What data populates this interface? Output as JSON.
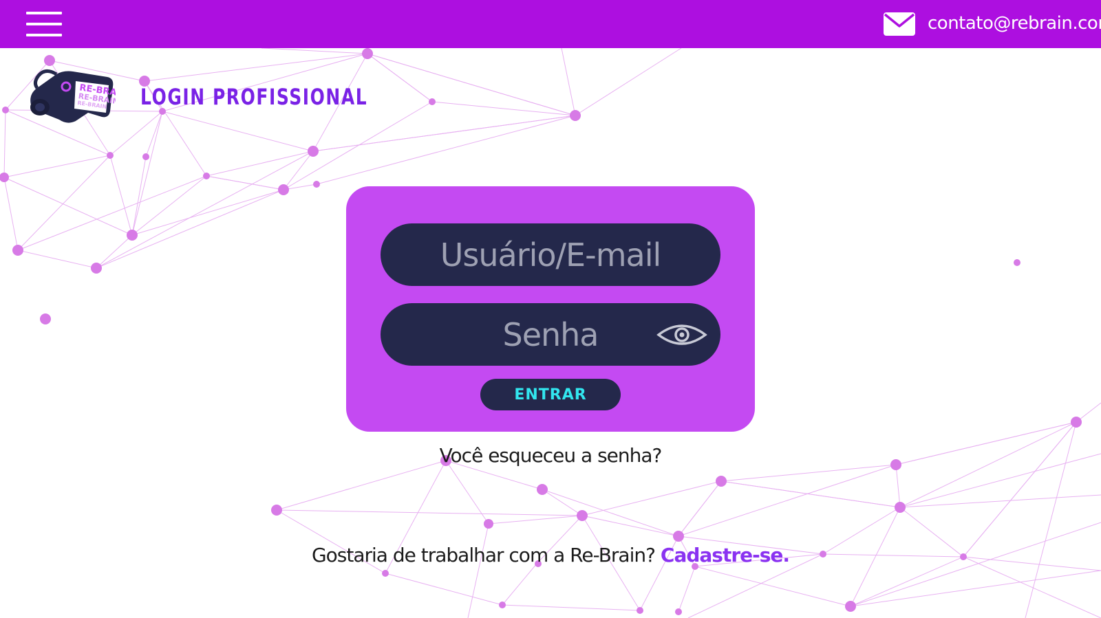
{
  "header": {
    "menu_icon": "hamburger-menu-icon",
    "mail_icon": "envelope-icon",
    "contact_email": "contato@rebrain.com"
  },
  "brand": {
    "logo_text": "RE-BRAIN",
    "page_title": "LOGIN PROFISSIONAL"
  },
  "login_form": {
    "username_placeholder": "Usuário/E-mail",
    "password_placeholder": "Senha",
    "show_password_icon": "eye-icon",
    "submit_label": "ENTRAR"
  },
  "links": {
    "forgot_password": "Você esqueceu a senha?",
    "signup_prompt": "Gostaria de trabalhar com a Re-Brain?",
    "signup_link": "Cadastre-se."
  },
  "colors": {
    "header_bg": "#ad0fe0",
    "card_bg": "#c44af2",
    "field_bg": "#24284b",
    "button_text": "#32e6ef",
    "title_text": "#7a22e6",
    "link_text": "#8a32f1",
    "network_nodes": "#d77ae6"
  }
}
